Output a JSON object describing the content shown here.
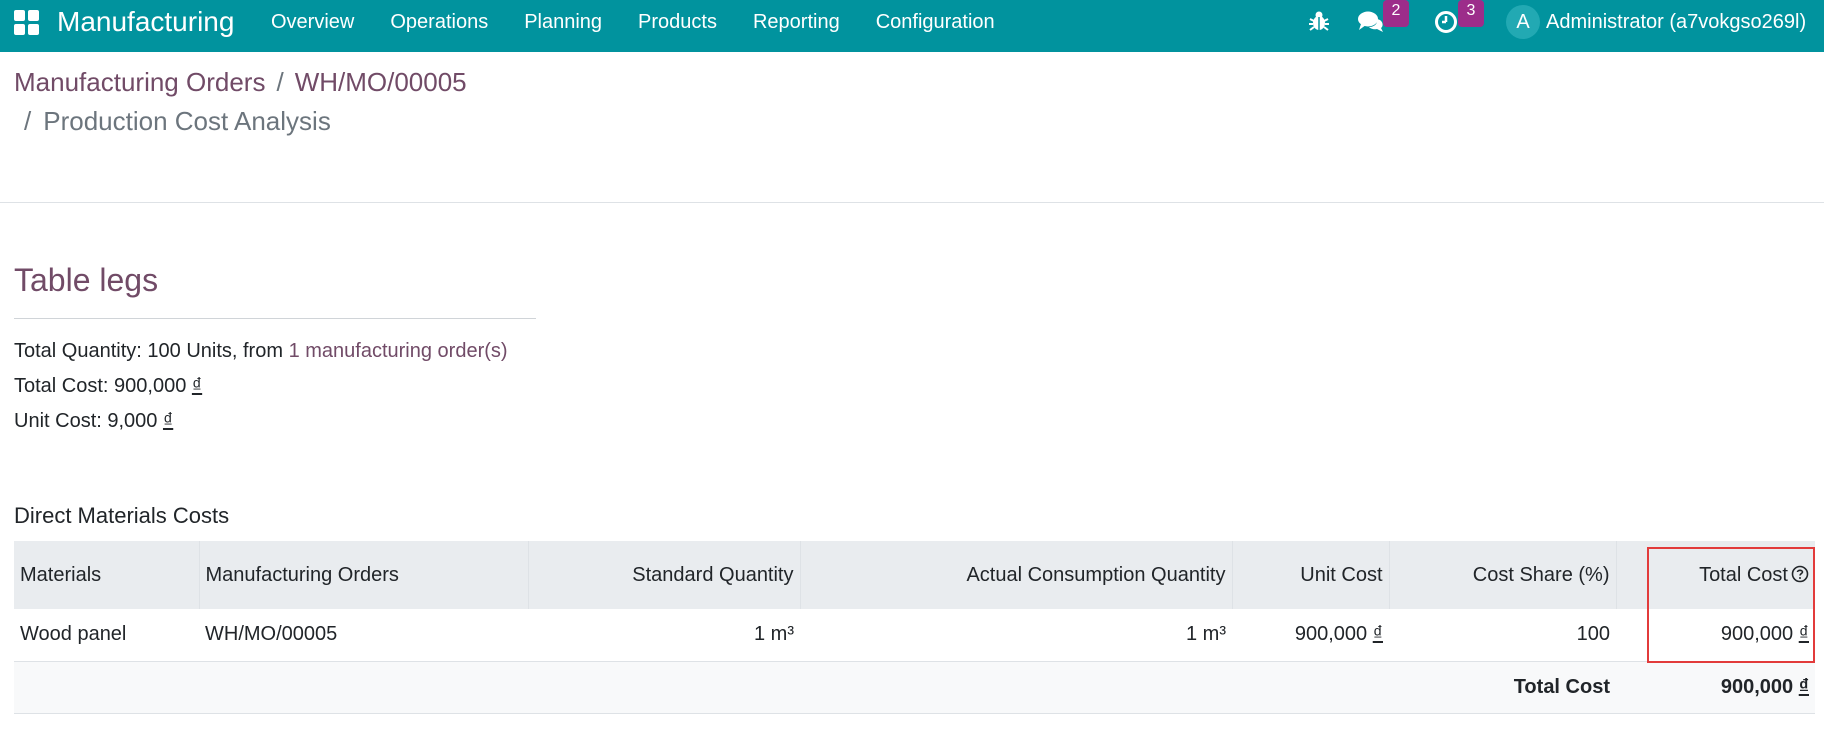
{
  "navbar": {
    "app_name": "Manufacturing",
    "menu": [
      "Overview",
      "Operations",
      "Planning",
      "Products",
      "Reporting",
      "Configuration"
    ],
    "messages_count": "2",
    "activities_count": "3",
    "avatar_letter": "A",
    "user_name": "Administrator (a7vokgso269l)",
    "colors": {
      "bar": "#01939e",
      "badge": "#9c2d8a"
    }
  },
  "breadcrumb": {
    "items": [
      "Manufacturing Orders",
      "WH/MO/00005"
    ],
    "current": "Production Cost Analysis",
    "separator": "/"
  },
  "product": {
    "name": "Table legs",
    "quantity_prefix": "Total Quantity: 100 Units, from ",
    "quantity_link": "1 manufacturing order(s)",
    "total_cost_label": "Total Cost: 900,000 ",
    "unit_cost_label": "Unit Cost: 9,000 ",
    "currency": "₫"
  },
  "direct_materials": {
    "title": "Direct Materials Costs",
    "columns": [
      "Materials",
      "Manufacturing Orders",
      "Standard Quantity",
      "Actual Consumption Quantity",
      "Unit Cost",
      "Cost Share (%)",
      "Total Cost"
    ],
    "rows": [
      {
        "material": "Wood panel",
        "order": "WH/MO/00005",
        "standard_qty": "1 m³",
        "actual_qty": "1 m³",
        "unit_cost": "900,000 ",
        "cost_share": "100",
        "total_cost": "900,000 "
      }
    ],
    "footer_label": "Total Cost",
    "footer_value": "900,000 "
  }
}
